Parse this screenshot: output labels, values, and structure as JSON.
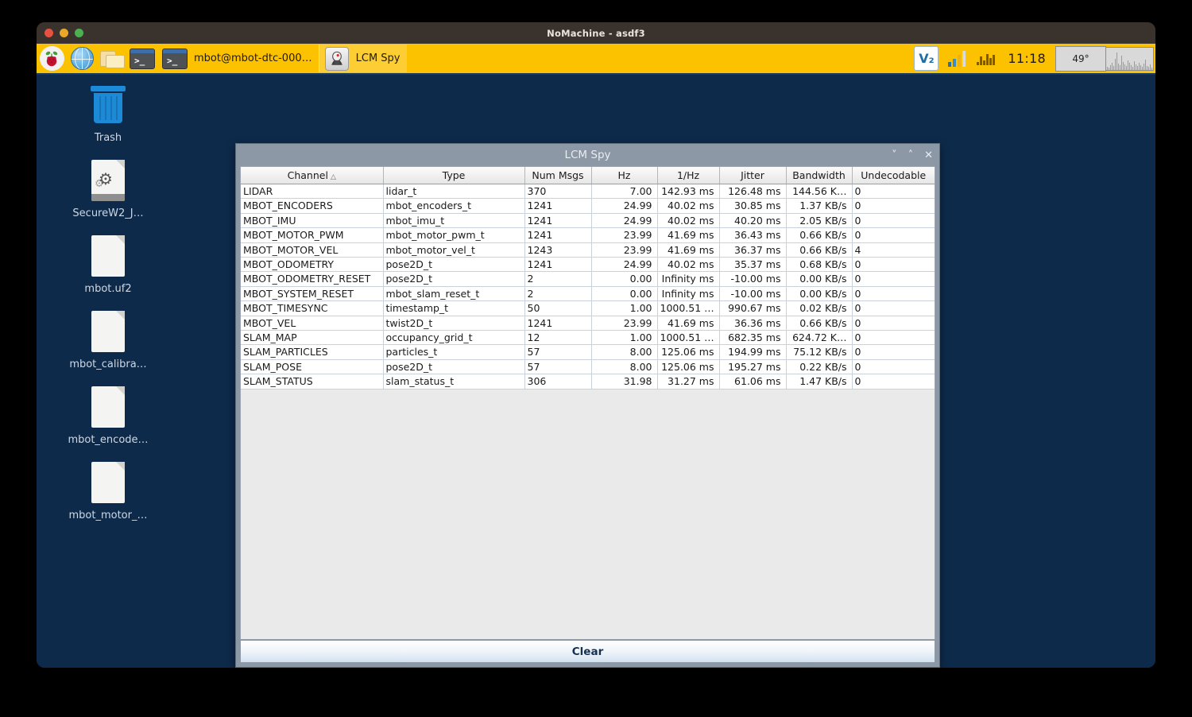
{
  "outer_window": {
    "title": "NoMachine - asdf3",
    "traffic_lights": [
      "close-red",
      "minimize-yellow",
      "maximize-green"
    ]
  },
  "taskbar": {
    "launchers": [
      {
        "name": "raspberry-pi-menu-icon",
        "label": ""
      },
      {
        "name": "web-browser-icon",
        "label": ""
      },
      {
        "name": "file-manager-icon",
        "label": ""
      },
      {
        "name": "terminal-icon",
        "label": ""
      }
    ],
    "tasks": [
      {
        "name": "task-terminal",
        "icon": "terminal-icon",
        "label": "mbot@mbot-dtc-000…"
      },
      {
        "name": "task-lcmspy",
        "icon": "java-duke-icon",
        "label": "LCM Spy"
      }
    ],
    "tray": {
      "vnc_label": "V₂",
      "clock": "11:18",
      "temperature": "49°"
    },
    "colors": {
      "background": "#fcc200",
      "text": "#231a04"
    }
  },
  "desktop": {
    "background": "#0d2a4b",
    "icons": [
      {
        "name": "desktop-icon-trash",
        "label": "Trash",
        "glyph": "trash-icon"
      },
      {
        "name": "desktop-icon-securew2",
        "label": "SecureW2_J…",
        "glyph": "executable-document-icon"
      },
      {
        "name": "desktop-icon-mbot-uf2",
        "label": "mbot.uf2",
        "glyph": "document-icon"
      },
      {
        "name": "desktop-icon-mbot-calibra",
        "label": "mbot_calibra…",
        "glyph": "document-icon"
      },
      {
        "name": "desktop-icon-mbot-encode",
        "label": "mbot_encode…",
        "glyph": "document-icon"
      },
      {
        "name": "desktop-icon-mbot-motor",
        "label": "mbot_motor_…",
        "glyph": "document-icon"
      }
    ]
  },
  "lcmspy": {
    "title": "LCM Spy",
    "window_buttons": [
      {
        "name": "minimize-button",
        "glyph": "˅"
      },
      {
        "name": "maximize-button",
        "glyph": "˄"
      },
      {
        "name": "close-button",
        "glyph": "✕"
      }
    ],
    "clear_label": "Clear",
    "table": {
      "sort_column": "Channel",
      "sort_direction": "ascending",
      "columns": [
        {
          "label": "Channel",
          "align": "left"
        },
        {
          "label": "Type",
          "align": "left"
        },
        {
          "label": "Num Msgs",
          "align": "left"
        },
        {
          "label": "Hz",
          "align": "right"
        },
        {
          "label": "1/Hz",
          "align": "right"
        },
        {
          "label": "Jitter",
          "align": "right"
        },
        {
          "label": "Bandwidth",
          "align": "right"
        },
        {
          "label": "Undecodable",
          "align": "left"
        }
      ],
      "rows": [
        [
          "LIDAR",
          "lidar_t",
          "370",
          "7.00",
          "142.93 ms",
          "126.48 ms",
          "144.56 K…",
          "0"
        ],
        [
          "MBOT_ENCODERS",
          "mbot_encoders_t",
          "1241",
          "24.99",
          "40.02 ms",
          "30.85 ms",
          "1.37 KB/s",
          "0"
        ],
        [
          "MBOT_IMU",
          "mbot_imu_t",
          "1241",
          "24.99",
          "40.02 ms",
          "40.20 ms",
          "2.05 KB/s",
          "0"
        ],
        [
          "MBOT_MOTOR_PWM",
          "mbot_motor_pwm_t",
          "1241",
          "23.99",
          "41.69 ms",
          "36.43 ms",
          "0.66 KB/s",
          "0"
        ],
        [
          "MBOT_MOTOR_VEL",
          "mbot_motor_vel_t",
          "1243",
          "23.99",
          "41.69 ms",
          "36.37 ms",
          "0.66 KB/s",
          "4"
        ],
        [
          "MBOT_ODOMETRY",
          "pose2D_t",
          "1241",
          "24.99",
          "40.02 ms",
          "35.37 ms",
          "0.68 KB/s",
          "0"
        ],
        [
          "MBOT_ODOMETRY_RESET",
          "pose2D_t",
          "2",
          "0.00",
          "Infinity ms",
          "-10.00 ms",
          "0.00 KB/s",
          "0"
        ],
        [
          "MBOT_SYSTEM_RESET",
          "mbot_slam_reset_t",
          "2",
          "0.00",
          "Infinity ms",
          "-10.00 ms",
          "0.00 KB/s",
          "0"
        ],
        [
          "MBOT_TIMESYNC",
          "timestamp_t",
          "50",
          "1.00",
          "1000.51 …",
          "990.67 ms",
          "0.02 KB/s",
          "0"
        ],
        [
          "MBOT_VEL",
          "twist2D_t",
          "1241",
          "23.99",
          "41.69 ms",
          "36.36 ms",
          "0.66 KB/s",
          "0"
        ],
        [
          "SLAM_MAP",
          "occupancy_grid_t",
          "12",
          "1.00",
          "1000.51 …",
          "682.35 ms",
          "624.72 K…",
          "0"
        ],
        [
          "SLAM_PARTICLES",
          "particles_t",
          "57",
          "8.00",
          "125.06 ms",
          "194.99 ms",
          "75.12 KB/s",
          "0"
        ],
        [
          "SLAM_POSE",
          "pose2D_t",
          "57",
          "8.00",
          "125.06 ms",
          "195.27 ms",
          "0.22 KB/s",
          "0"
        ],
        [
          "SLAM_STATUS",
          "slam_status_t",
          "306",
          "31.98",
          "31.27 ms",
          "61.06 ms",
          "1.47 KB/s",
          "0"
        ]
      ]
    }
  }
}
